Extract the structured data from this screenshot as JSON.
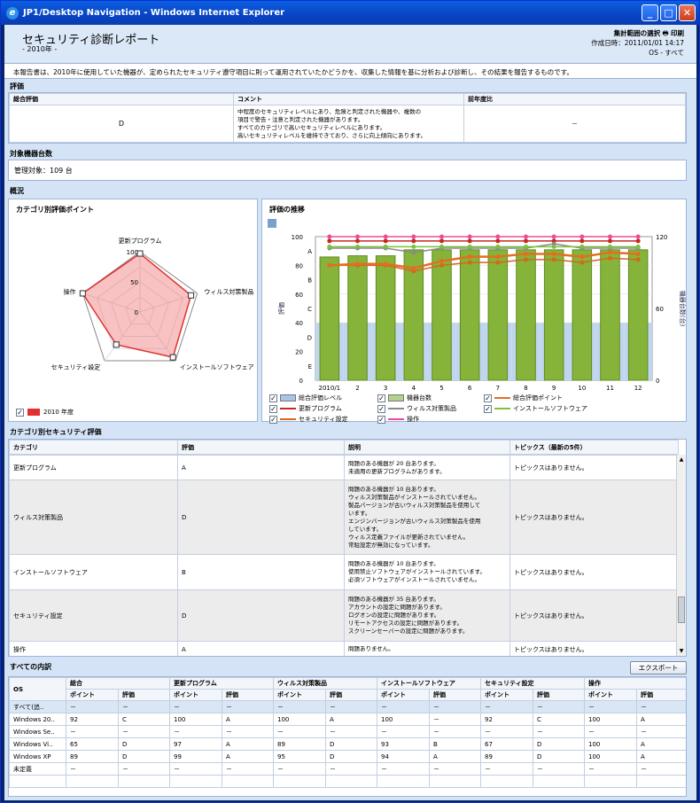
{
  "window": {
    "title": "JP1/Desktop Navigation - Windows Internet Explorer"
  },
  "header": {
    "title": "セキュリティ診断レポート",
    "subtitle": "- 2010年 -",
    "range_label": "集計範囲の選択",
    "print_label": "印刷",
    "created": "作成日時：2011/01/01 14:17",
    "os_filter": "OS - すべて"
  },
  "intro": "本報告書は、2010年に使用していた機器が、定められたセキュリティ遵守項目に則って運用されていたかどうかを、収集した情報を基に分析および診断し、その結果を報告するものです。",
  "evaluation": {
    "section": "評価",
    "col_overall": "総合評価",
    "col_comment": "コメント",
    "col_prev": "前年度比",
    "overall": "D",
    "comment": [
      "中程度のセキュリティレベルにあり、危険と判定された機器や、複数の",
      "項目で警告・注意と判定された機器があります。",
      "すべてのカテゴリで高いセキュリティレベルにあります。",
      "高いセキュリティレベルを維持できており、さらに向上傾向にあります。"
    ],
    "prev": "－"
  },
  "devices": {
    "section": "対象機器台数",
    "text": "管理対象：109 台"
  },
  "overview": {
    "section": "概況"
  },
  "radar": {
    "title": "カテゴリ別評価ポイント",
    "axes": [
      "更新プログラム",
      "ウィルス対策製品",
      "インストールソフトウェア",
      "セキュリティ設定",
      "操作"
    ],
    "values": [
      97,
      89,
      93,
      67,
      100
    ],
    "ticks": [
      "100",
      "50",
      "0"
    ],
    "legend": "2010 年度",
    "series_color": "#e03030"
  },
  "trend": {
    "title": "評価の推移",
    "ylabel": "評価",
    "y2label": "機器台数(台)",
    "yticks": [
      "100",
      "80",
      "60",
      "40",
      "20",
      "0"
    ],
    "y2ticks": [
      "120",
      "60",
      "0"
    ],
    "grades": [
      "A",
      "B",
      "C",
      "D",
      "E"
    ],
    "xticks": [
      "2010/1",
      "2",
      "3",
      "4",
      "5",
      "6",
      "7",
      "8",
      "9",
      "10",
      "11",
      "12"
    ],
    "legend": [
      "総合評価レベル",
      "機器台数",
      "総合評価ポイント",
      "更新プログラム",
      "ウィルス対策製品",
      "インストールソフトウェア",
      "セキュリティ設定",
      "操作"
    ]
  },
  "chart_data": {
    "type": "bar",
    "categories": [
      "2010/1",
      "2",
      "3",
      "4",
      "5",
      "6",
      "7",
      "8",
      "9",
      "10",
      "11",
      "12"
    ],
    "ylim": [
      0,
      100
    ],
    "y2lim": [
      0,
      120
    ],
    "series": [
      {
        "name": "総合評価レベル",
        "values": [
          40,
          40,
          40,
          40,
          40,
          40,
          40,
          40,
          40,
          40,
          40,
          40
        ]
      },
      {
        "name": "機器台数",
        "values": [
          103,
          104,
          104,
          109,
          109,
          109,
          109,
          109,
          109,
          109,
          109,
          109
        ]
      },
      {
        "name": "総合評価ポイント",
        "values": [
          80,
          81,
          81,
          78,
          83,
          86,
          86,
          88,
          88,
          86,
          89,
          88
        ]
      },
      {
        "name": "更新プログラム",
        "values": [
          97,
          97,
          97,
          97,
          97,
          97,
          97,
          97,
          97,
          97,
          97,
          97
        ]
      },
      {
        "name": "ウィルス対策製品",
        "values": [
          92,
          92,
          92,
          89,
          92,
          92,
          92,
          92,
          95,
          92,
          92,
          92
        ]
      },
      {
        "name": "インストールソフトウェア",
        "values": [
          93,
          93,
          93,
          93,
          93,
          93,
          93,
          93,
          93,
          93,
          93,
          93
        ]
      },
      {
        "name": "セキュリティ設定",
        "values": [
          80,
          80,
          80,
          76,
          80,
          82,
          82,
          84,
          84,
          82,
          85,
          84
        ]
      },
      {
        "name": "操作",
        "values": [
          100,
          100,
          100,
          100,
          100,
          100,
          100,
          100,
          100,
          100,
          100,
          100
        ]
      }
    ]
  },
  "categories": {
    "section": "カテゴリ別セキュリティ評価",
    "headers": [
      "カテゴリ",
      "評価",
      "説明",
      "トピックス（最新の5件）"
    ],
    "rows": [
      {
        "name": "更新プログラム",
        "grade": "A",
        "desc": [
          "問題のある機器が 20 台あります。",
          "未適用の更新プログラムがあります。"
        ],
        "topic": "トピックスはありません。"
      },
      {
        "name": "ウィルス対策製品",
        "grade": "D",
        "desc": [
          "問題のある機器が 10 台あります。",
          "ウィルス対策製品がインストールされていません。",
          "製品バージョンが古いウィルス対策製品を使用して",
          "います。",
          "エンジンバージョンが古いウィルス対策製品を使用",
          "しています。",
          "ウィルス定義ファイルが更新されていません。",
          "常駐設定が無効になっています。"
        ],
        "topic": "トピックスはありません。"
      },
      {
        "name": "インストールソフトウェア",
        "grade": "B",
        "desc": [
          "問題のある機器が 10 台あります。",
          "使用禁止ソフトウェアがインストールされています。",
          "必須ソフトウェアがインストールされていません。"
        ],
        "topic": "トピックスはありません。"
      },
      {
        "name": "セキュリティ設定",
        "grade": "D",
        "desc": [
          "問題のある機器が 35 台あります。",
          "アカウントの設定に問題があります。",
          "ログオンの設定に問題があります。",
          "リモートアクセスの設定に問題があります。",
          "スクリーンセーバーの設定に問題があります。"
        ],
        "topic": "トピックスはありません。"
      },
      {
        "name": "操作",
        "grade": "A",
        "desc": [
          "問題ありません。"
        ],
        "topic": "トピックスはありません。"
      }
    ]
  },
  "breakdown": {
    "section": "すべての内訳",
    "export": "エクスポート",
    "os_header": "OS",
    "groups": [
      "総合",
      "更新プログラム",
      "ウィルス対策製品",
      "インストールソフトウェア",
      "セキュリティ設定",
      "操作"
    ],
    "sub": [
      "ポイント",
      "評価"
    ],
    "rows": [
      [
        "すべて(追..",
        "－",
        "－",
        "－",
        "－",
        "－",
        "－",
        "－",
        "－",
        "－",
        "－",
        "－",
        "－"
      ],
      [
        "Windows 20..",
        "92",
        "C",
        "100",
        "A",
        "100",
        "A",
        "100",
        "－",
        "92",
        "C",
        "100",
        "A"
      ],
      [
        "Windows Se..",
        "－",
        "－",
        "－",
        "－",
        "－",
        "－",
        "－",
        "－",
        "－",
        "－",
        "－",
        "－"
      ],
      [
        "Windows Vi..",
        "65",
        "D",
        "97",
        "A",
        "89",
        "D",
        "93",
        "B",
        "67",
        "D",
        "100",
        "A"
      ],
      [
        "Windows XP",
        "89",
        "D",
        "99",
        "A",
        "95",
        "D",
        "94",
        "A",
        "89",
        "D",
        "100",
        "A"
      ],
      [
        "未定義",
        "－",
        "－",
        "－",
        "－",
        "－",
        "－",
        "－",
        "－",
        "－",
        "－",
        "－",
        "－"
      ]
    ]
  }
}
